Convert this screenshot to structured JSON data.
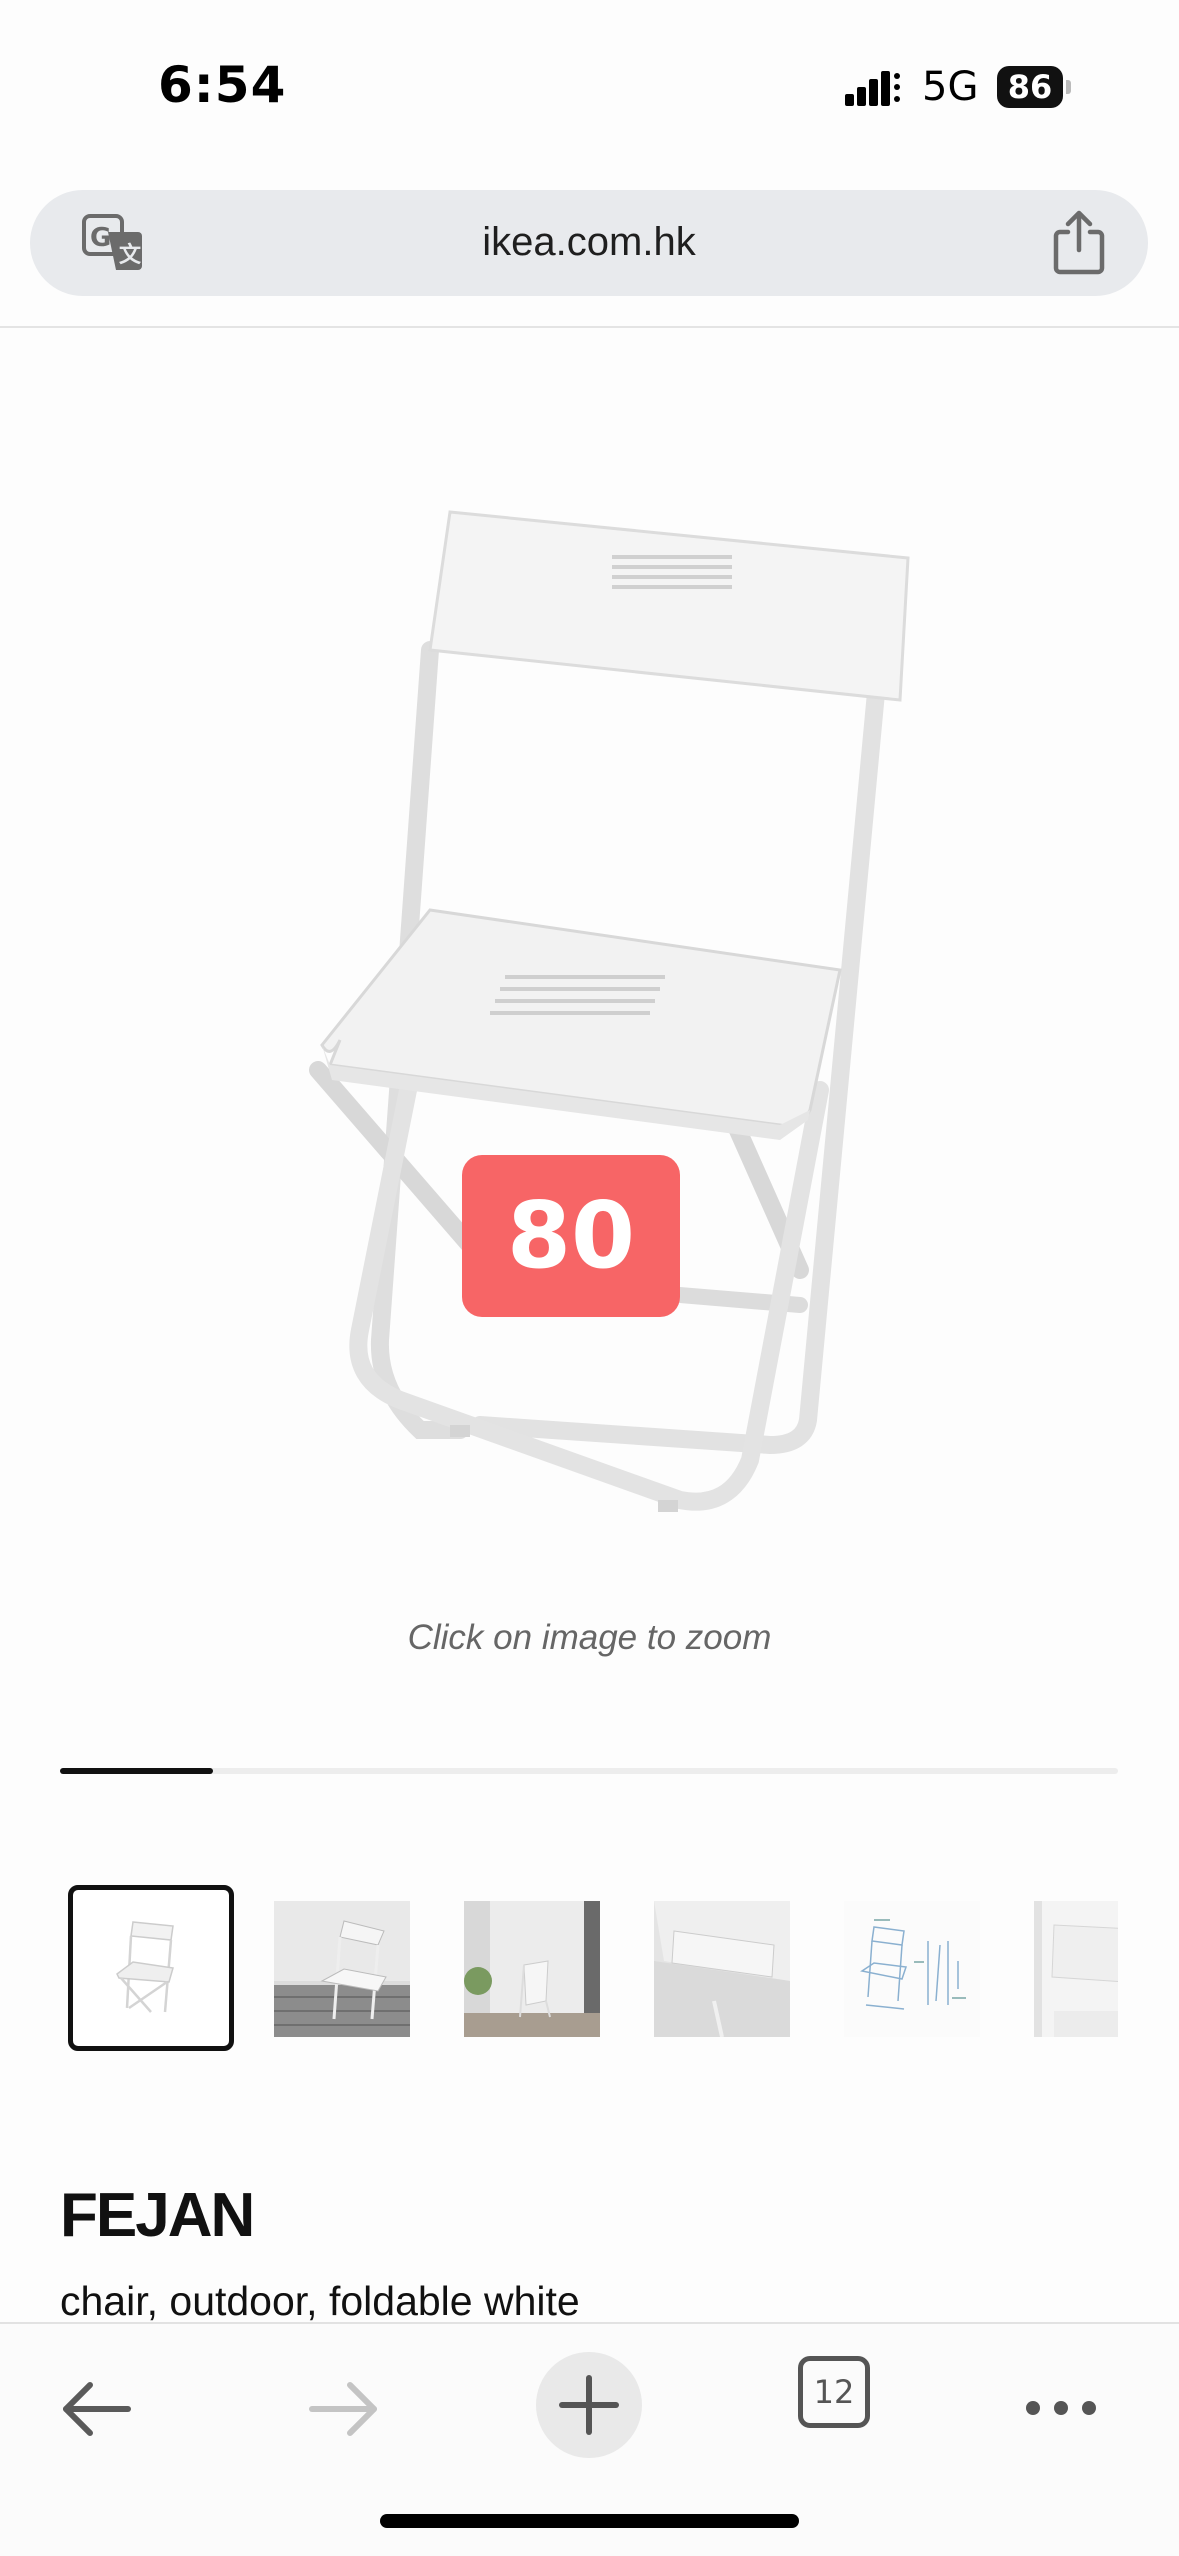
{
  "status_bar": {
    "time": "6:54",
    "network": "5G",
    "battery": "86"
  },
  "address_bar": {
    "url": "ikea.com.hk",
    "translate_icon": "google-translate-icon",
    "share_icon": "share-icon"
  },
  "product": {
    "image_badge": "80",
    "zoom_hint": "Click on image to zoom",
    "gallery_progress": 0.145,
    "thumbnail_count": 6,
    "name": "FEJAN",
    "description": "chair, outdoor, foldable white"
  },
  "toolbar": {
    "back_icon": "back-arrow-icon",
    "forward_icon": "forward-arrow-icon",
    "new_tab_icon": "plus-icon",
    "tab_count": "12",
    "menu_icon": "more-icon"
  },
  "colors": {
    "badge": "#f76566",
    "address_bar": "#e8eaed",
    "text": "#111111"
  }
}
